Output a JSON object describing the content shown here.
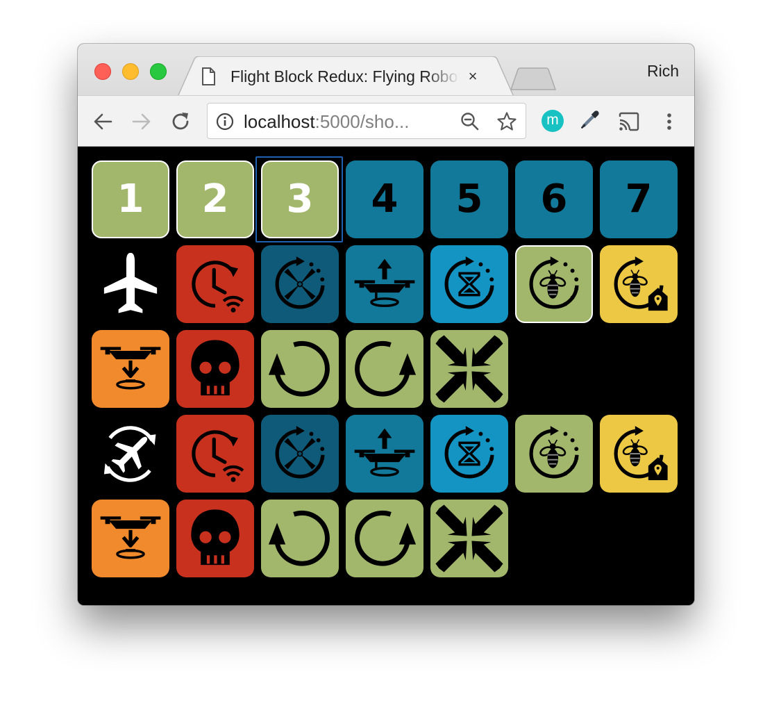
{
  "browser": {
    "tab_title": "Flight Block Redux: Flying Robots",
    "tab_close": "×",
    "profile_name": "Rich",
    "url_host": "localhost",
    "url_rest": ":5000/sho...",
    "extension_letter": "m"
  },
  "colors": {
    "green": "#a2b76c",
    "blue": "#13799a",
    "darkblue": "#0f5a79",
    "lightblue": "#1494c2",
    "red": "#c8311e",
    "orange": "#f18a2c",
    "yellow": "#edc845"
  },
  "levels": [
    "1",
    "2",
    "3",
    "4",
    "5",
    "6",
    "7"
  ],
  "palette": [
    {
      "icon": "airplane-icon",
      "color": "none"
    },
    {
      "icon": "wait-for-signal-icon",
      "color": "red"
    },
    {
      "icon": "spin-propellers-icon",
      "color": "darkblue"
    },
    {
      "icon": "takeoff-icon",
      "color": "blue"
    },
    {
      "icon": "hourglass-loop-icon",
      "color": "lightblue"
    },
    {
      "icon": "bee-loop-icon",
      "color": "green"
    },
    {
      "icon": "bee-home-icon",
      "color": "yellow"
    },
    {
      "icon": "land-icon",
      "color": "orange"
    },
    {
      "icon": "skull-icon",
      "color": "red"
    },
    {
      "icon": "rotate-left-icon",
      "color": "green"
    },
    {
      "icon": "rotate-right-icon",
      "color": "green"
    },
    {
      "icon": "compress-icon",
      "color": "green"
    }
  ],
  "program": [
    {
      "icon": "plane-loop-icon",
      "color": "none"
    },
    {
      "icon": "wait-for-signal-icon",
      "color": "red"
    },
    {
      "icon": "spin-propellers-icon",
      "color": "darkblue"
    },
    {
      "icon": "takeoff-icon",
      "color": "blue"
    },
    {
      "icon": "hourglass-loop-icon",
      "color": "lightblue"
    },
    {
      "icon": "bee-loop-icon",
      "color": "green"
    },
    {
      "icon": "bee-home-icon",
      "color": "yellow"
    },
    {
      "icon": "land-icon",
      "color": "orange"
    },
    {
      "icon": "skull-icon",
      "color": "red"
    },
    {
      "icon": "rotate-left-icon",
      "color": "green"
    },
    {
      "icon": "rotate-right-icon",
      "color": "green"
    },
    {
      "icon": "compress-icon",
      "color": "green"
    }
  ]
}
